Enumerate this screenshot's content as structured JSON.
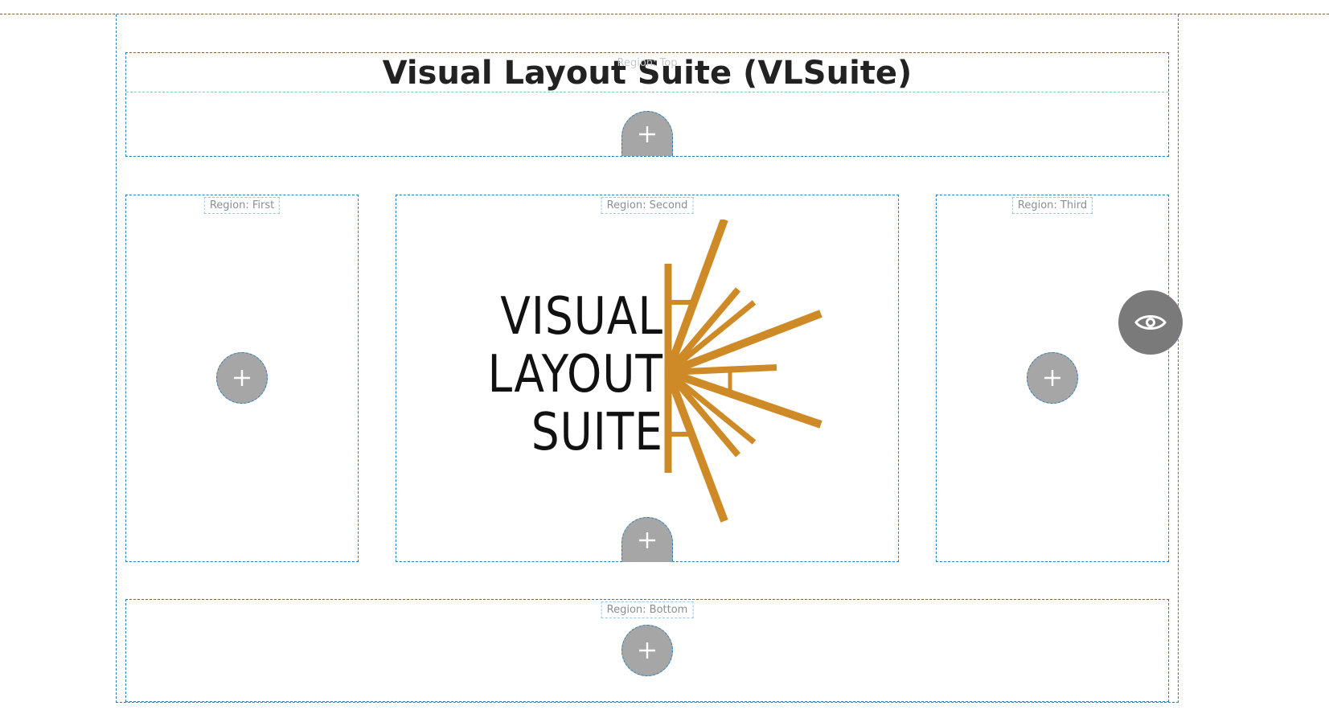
{
  "page": {
    "title": "Visual Layout Suite (VLSuite)"
  },
  "regions": {
    "top": {
      "label": "Region: Top"
    },
    "first": {
      "label": "Region: First"
    },
    "second": {
      "label": "Region: Second"
    },
    "third": {
      "label": "Region: Third"
    },
    "bottom": {
      "label": "Region: Bottom"
    }
  },
  "logo": {
    "lines": [
      "VISUAL",
      "LAYOUT",
      "SUITE"
    ],
    "accent_color": "#cf8a28"
  },
  "icons": {
    "add_block": "plus-icon",
    "preview": "eye-icon"
  }
}
